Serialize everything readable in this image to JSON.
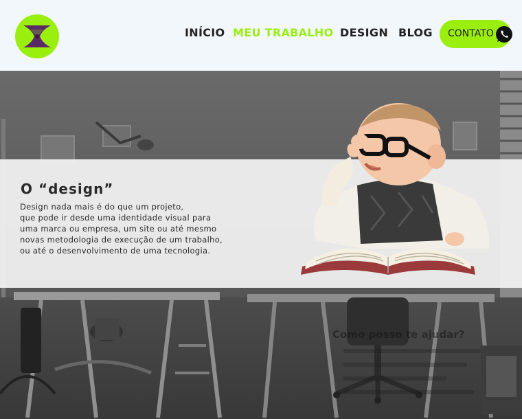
{
  "nav": {
    "items": [
      "INÍCIO",
      "MEU TRABALHO",
      "DESIGN",
      "BLOG"
    ],
    "active": "MEU TRABALHO",
    "contact_label": "CONTATO"
  },
  "colors": {
    "accent": "#9bef0f",
    "logo_symbol": "#5a2a66",
    "header_bg": "#f2f7fc",
    "text_dark": "#222222"
  },
  "icons": {
    "logo": "hourglass-x-logo",
    "contact": "whatsapp-icon"
  },
  "intro": {
    "title": "O “design”",
    "lines": [
      "Design nada mais é do que um projeto,",
      "que pode ir desde uma identidade visual para",
      "uma marca ou empresa, um site ou até mesmo",
      "novas metodologia de execução de um trabalho,",
      "ou até o desenvolvimento de uma tecnologia."
    ]
  },
  "faded": {
    "heading": "Como posso te ajudar?"
  }
}
